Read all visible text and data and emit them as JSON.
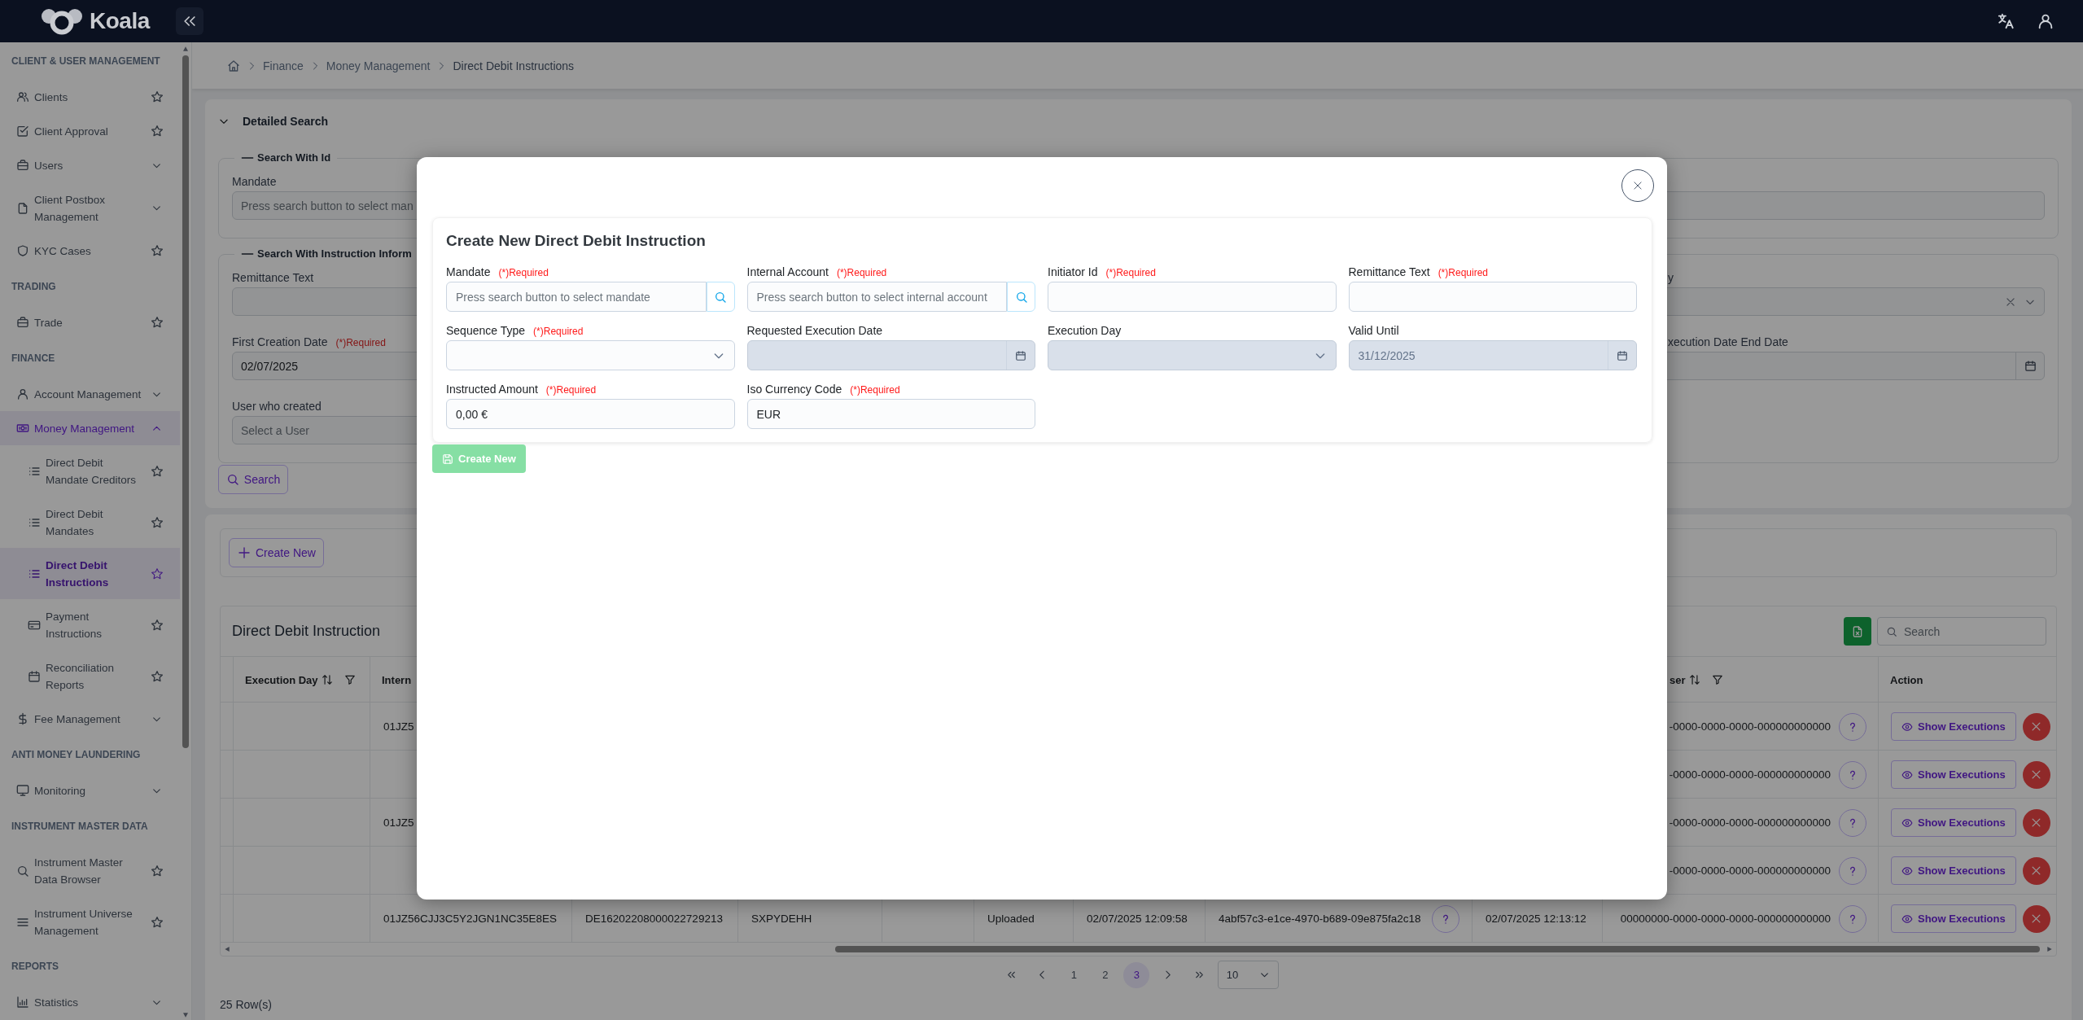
{
  "top_bar": {
    "logo": "Koala"
  },
  "sidebar": {
    "sections": [
      {
        "title": "CLIENT & USER MANAGEMENT",
        "items": [
          {
            "label": "Clients",
            "kind": "link",
            "selected": false,
            "favorite": false
          },
          {
            "label": "Client Approval",
            "kind": "link",
            "selected": false,
            "favorite": false
          },
          {
            "label": "Users",
            "kind": "group",
            "selected": false,
            "expanded": false
          },
          {
            "label": "Client Postbox Management",
            "kind": "group",
            "selected": false,
            "expanded": false
          },
          {
            "label": "KYC Cases",
            "kind": "link",
            "selected": false,
            "favorite": false
          }
        ]
      },
      {
        "title": "TRADING",
        "items": [
          {
            "label": "Trade",
            "kind": "link",
            "selected": false,
            "favorite": false
          }
        ]
      },
      {
        "title": "FINANCE",
        "items": [
          {
            "label": "Account Management",
            "kind": "group",
            "selected": false,
            "expanded": false
          },
          {
            "label": "Money Management",
            "kind": "group",
            "selected": false,
            "expanded": true,
            "children": [
              {
                "label": "Direct Debit Mandate Creditors",
                "kind": "link",
                "selected": false,
                "favorite": false
              },
              {
                "label": "Direct Debit Mandates",
                "kind": "link",
                "selected": false,
                "favorite": false
              },
              {
                "label": "Direct Debit Instructions",
                "kind": "link",
                "selected": true,
                "favorite": false
              },
              {
                "label": "Payment Instructions",
                "kind": "link",
                "selected": false,
                "favorite": false
              },
              {
                "label": "Reconciliation Reports",
                "kind": "link",
                "selected": false,
                "favorite": false
              }
            ]
          },
          {
            "label": "Fee Management",
            "kind": "group",
            "selected": false,
            "expanded": false
          }
        ]
      },
      {
        "title": "ANTI MONEY LAUNDERING",
        "items": [
          {
            "label": "Monitoring",
            "kind": "group",
            "selected": false,
            "expanded": false
          }
        ]
      },
      {
        "title": "INSTRUMENT MASTER DATA",
        "items": [
          {
            "label": "Instrument Master Data Browser",
            "kind": "link",
            "selected": false,
            "favorite": false
          },
          {
            "label": "Instrument Universe Management",
            "kind": "link",
            "selected": false,
            "favorite": false
          }
        ]
      },
      {
        "title": "REPORTS",
        "items": [
          {
            "label": "Statistics",
            "kind": "group",
            "selected": false,
            "expanded": false
          }
        ]
      }
    ]
  },
  "breadcrumb": {
    "items": [
      "Finance",
      "Money Management",
      "Direct Debit Instructions"
    ]
  },
  "detailed_search": {
    "title": "Detailed Search",
    "expanded": true,
    "groups": [
      {
        "title": "Search With Id",
        "expanded": true,
        "fields": [
          {
            "label": "Mandate",
            "kind": "text",
            "placeholder": "Press search button to select man"
          },
          {
            "kind": "text"
          }
        ]
      },
      {
        "title": "Search With Instruction Inform",
        "expanded": true,
        "fields": [
          {
            "label": "Remittance Text",
            "kind": "text"
          },
          {
            "label": "y",
            "kind": "clearable_select"
          },
          {
            "label": "First Creation Date",
            "note": "(*)Required",
            "kind": "text",
            "value": "02/07/2025"
          },
          {
            "label": "xecution Date End Date",
            "kind": "date"
          },
          {
            "label": "User who created",
            "kind": "text",
            "placeholder": "Select a User"
          }
        ]
      }
    ],
    "search_button": "Search"
  },
  "records": {
    "create_button": "Create New",
    "title": "Direct Debit Instruction",
    "search_placeholder": "Search",
    "columns": {
      "column_2": {
        "label": "Execution Day",
        "sortable": true,
        "filterable": true
      },
      "column_3": {
        "label": "Intern",
        "sortable": false,
        "filterable": false
      },
      "column_11": {
        "label": "ser",
        "sortable": true,
        "filterable": true
      },
      "column_12": {
        "label": "Action",
        "sortable": false,
        "filterable": false
      }
    },
    "rows": [
      {
        "column_3": "01JZ5",
        "column_11": "-0000-0000-0000-000000000000",
        "column_12": "Show Executions"
      },
      {
        "column_11": "-0000-0000-0000-000000000000",
        "column_12": "Show Executions"
      },
      {
        "column_3": "01JZ5",
        "column_11": "-0000-0000-0000-000000000000",
        "column_12": "Show Executions"
      },
      {
        "column_11": "-0000-0000-0000-000000000000",
        "column_12": "Show Executions"
      },
      {
        "column_3": "01JZ56CJJ3C5Y2JGN1NC35E8ES",
        "column_4": "DE16202208000022729213",
        "column_5": "SXPYDEHH",
        "column_7": "Uploaded",
        "column_8": "02/07/2025 12:09:58",
        "column_9": "4abf57c3-e1ce-4970-b689-09e875fa2c18",
        "column_10": "02/07/2025 12:13:12",
        "column_11": "00000000-0000-0000-0000-000000000000",
        "column_12": "Show Executions"
      }
    ],
    "pagination": {
      "pages": [
        {
          "label": "1",
          "selected": false
        },
        {
          "label": "2",
          "selected": false
        },
        {
          "label": "3",
          "selected": true
        }
      ],
      "page_size": "10"
    },
    "row_count": "25 Row(s)"
  },
  "modal": {
    "title": "Create New Direct Debit Instruction",
    "fields": [
      {
        "label": "Mandate",
        "note": "(*)Required",
        "kind": "search",
        "placeholder": "Press search button to select mandate",
        "disabled": false
      },
      {
        "label": "Internal Account",
        "note": "(*)Required",
        "kind": "search",
        "placeholder": "Press search button to select internal account",
        "disabled": false
      },
      {
        "label": "Initiator Id",
        "note": "(*)Required",
        "kind": "text",
        "disabled": false
      },
      {
        "label": "Remittance Text",
        "note": "(*)Required",
        "kind": "text",
        "disabled": false
      },
      {
        "label": "Sequence Type",
        "note": "(*)Required",
        "kind": "select",
        "disabled": false
      },
      {
        "label": "Requested Execution Date",
        "kind": "date",
        "disabled": true
      },
      {
        "label": "Execution Day",
        "kind": "select",
        "disabled": true
      },
      {
        "label": "Valid Until",
        "kind": "date",
        "value": "31/12/2025",
        "disabled": true
      },
      {
        "label": "Instructed Amount",
        "note": "(*)Required",
        "kind": "text",
        "value": "0,00 €",
        "disabled": false
      },
      {
        "label": "Iso Currency Code",
        "note": "(*)Required",
        "kind": "text",
        "value": "EUR",
        "disabled": false
      }
    ],
    "submit": {
      "label": "Create New",
      "disabled": true
    }
  }
}
